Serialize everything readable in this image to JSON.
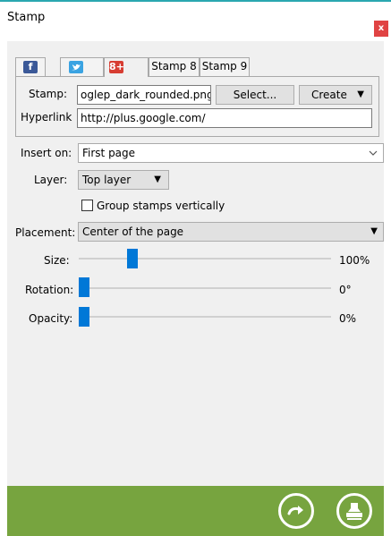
{
  "window": {
    "title": "Stamp",
    "close_label": "x"
  },
  "tabs": [
    {
      "label": "f",
      "icon": "facebook-icon",
      "color": "#3b5998"
    },
    {
      "label": "",
      "icon": "twitter-icon",
      "color": "#3aa3e2"
    },
    {
      "label": "8+",
      "icon": "google-plus-icon",
      "color": "#d73d32"
    },
    {
      "label": "Stamp 8"
    },
    {
      "label": "Stamp 9"
    }
  ],
  "stamp_group": {
    "stamp_label": "Stamp:",
    "stamp_file": "oglep_dark_rounded.png",
    "select_label": "Select...",
    "create_label": "Create",
    "hyperlink_label": "Hyperlink",
    "hyperlink_value": "http://plus.google.com/"
  },
  "insert_on": {
    "label": "Insert on:",
    "value": "First page"
  },
  "layer": {
    "label": "Layer:",
    "value": "Top layer"
  },
  "group_vertical": {
    "label": "Group stamps vertically",
    "checked": false
  },
  "placement": {
    "label": "Placement:",
    "value": "Center of the page"
  },
  "size": {
    "label": "Size:",
    "value_text": "100%",
    "level": 0.2
  },
  "rotation": {
    "label": "Rotation:",
    "value_text": "0°",
    "level": 0.0
  },
  "opacity": {
    "label": "Opacity:",
    "value_text": "0%",
    "level": 0.0
  },
  "footer": {
    "color": "#77a43f",
    "next_icon": "arrow-right-icon",
    "apply_icon": "stamp-icon"
  }
}
